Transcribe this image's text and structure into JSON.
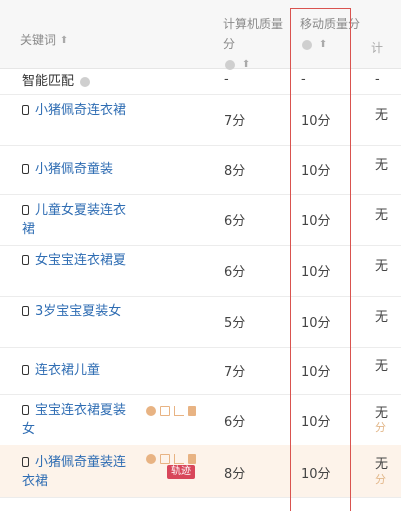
{
  "header": {
    "keyword": "关键词",
    "pc_quality": "计算机质量分",
    "mobile_quality": "移动质量分",
    "next_col": "计"
  },
  "rows": [
    {
      "keyword": "智能匹配",
      "pc": "-",
      "mobile": "-",
      "next": "-"
    },
    {
      "keyword": "小猪佩奇连衣裙",
      "pc": "7分",
      "mobile": "10分",
      "next": "无"
    },
    {
      "keyword": "小猪佩奇童装",
      "pc": "8分",
      "mobile": "10分",
      "next": "无"
    },
    {
      "keyword": "儿童女夏装连衣裙",
      "pc": "6分",
      "mobile": "10分",
      "next": "无"
    },
    {
      "keyword": "女宝宝连衣裙夏",
      "pc": "6分",
      "mobile": "10分",
      "next": "无"
    },
    {
      "keyword": "3岁宝宝夏装女",
      "pc": "5分",
      "mobile": "10分",
      "next": "无"
    },
    {
      "keyword": "连衣裙儿童",
      "pc": "7分",
      "mobile": "10分",
      "next": "无"
    },
    {
      "keyword": "宝宝连衣裙夏装女",
      "pc": "6分",
      "mobile": "10分",
      "next": "无",
      "next_sub": "分"
    },
    {
      "keyword": "小猪佩奇童装连衣裙",
      "pc": "8分",
      "mobile": "10分",
      "next": "无",
      "next_sub": "分",
      "badge": "轨迹"
    }
  ],
  "colors": {
    "accent_link": "#2f6db3",
    "highlight_border": "#d9534f",
    "selected_row": "#fdf3ea"
  }
}
